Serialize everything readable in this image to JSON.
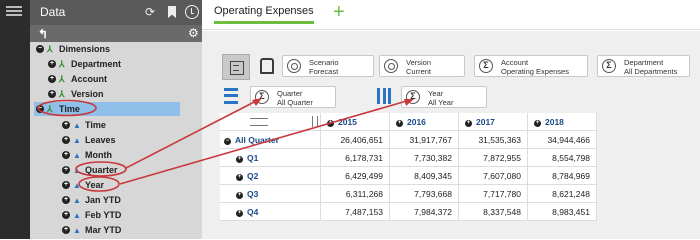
{
  "panel": {
    "title": "Data"
  },
  "tree": [
    {
      "label": "Dimensions",
      "toggle": "−",
      "icon": "dimension-icon",
      "icon_glyph": "⅄"
    },
    {
      "label": "Department",
      "toggle": "+",
      "icon": "dimension-icon",
      "icon_glyph": "⅄"
    },
    {
      "label": "Account",
      "toggle": "+",
      "icon": "dimension-icon",
      "icon_glyph": "⅄"
    },
    {
      "label": "Version",
      "toggle": "+",
      "icon": "dimension-icon",
      "icon_glyph": "⅄"
    },
    {
      "label": "Time",
      "toggle": "−",
      "icon": "dimension-icon",
      "icon_glyph": "⅄",
      "selected": true
    },
    {
      "label": "Time",
      "toggle": "+",
      "icon": "level-icon",
      "icon_glyph": "▲"
    },
    {
      "label": "Leaves",
      "toggle": "+",
      "icon": "level-icon",
      "icon_glyph": "▲"
    },
    {
      "label": "Month",
      "toggle": "+",
      "icon": "level-icon",
      "icon_glyph": "▲"
    },
    {
      "label": "Quarter",
      "toggle": "+",
      "icon": "level-icon",
      "icon_glyph": "▲"
    },
    {
      "label": "Year",
      "toggle": "+",
      "icon": "level-icon",
      "icon_glyph": "▲"
    },
    {
      "label": "Jan YTD",
      "toggle": "+",
      "icon": "level-icon",
      "icon_glyph": "▲"
    },
    {
      "label": "Feb YTD",
      "toggle": "+",
      "icon": "level-icon",
      "icon_glyph": "▲"
    },
    {
      "label": "Mar YTD",
      "toggle": "+",
      "icon": "level-icon",
      "icon_glyph": "▲"
    }
  ],
  "tab": {
    "label": "Operating Expenses",
    "add_glyph": "+"
  },
  "pov": {
    "scenario": {
      "name": "Scenario",
      "value": "Forecast"
    },
    "version": {
      "name": "Version",
      "value": "Current"
    },
    "account": {
      "name": "Account",
      "value": "Operating Expenses",
      "symbol": "Σ"
    },
    "department": {
      "name": "Department",
      "value": "All Departments",
      "symbol": "Σ"
    }
  },
  "rows_tile": {
    "name": "Quarter",
    "value": "All Quarter",
    "symbol": "Σ"
  },
  "cols_tile": {
    "name": "Year",
    "value": "All Year",
    "symbol": "Σ"
  },
  "grid": {
    "toggle": "+",
    "columns": [
      "2015",
      "2016",
      "2017",
      "2018"
    ],
    "rows": [
      {
        "label": "All Quarter",
        "toggle": "−",
        "values": [
          "26,406,651",
          "31,917,767",
          "31,535,363",
          "34,944,466"
        ]
      },
      {
        "label": "Q1",
        "toggle": "+",
        "values": [
          "6,178,731",
          "7,730,382",
          "7,872,955",
          "8,554,798"
        ]
      },
      {
        "label": "Q2",
        "toggle": "+",
        "values": [
          "6,429,499",
          "8,409,345",
          "7,607,080",
          "8,784,969"
        ]
      },
      {
        "label": "Q3",
        "toggle": "+",
        "values": [
          "6,311,268",
          "7,793,668",
          "7,717,780",
          "8,621,248"
        ]
      },
      {
        "label": "Q4",
        "toggle": "+",
        "values": [
          "7,487,153",
          "7,984,372",
          "8,337,548",
          "8,983,451"
        ]
      }
    ]
  },
  "colors": {
    "accent_green": "#6cbf3e",
    "selection_blue": "#8ec0ea",
    "annotation_red": "#c8383c",
    "header_blue": "#1a4a8a"
  }
}
